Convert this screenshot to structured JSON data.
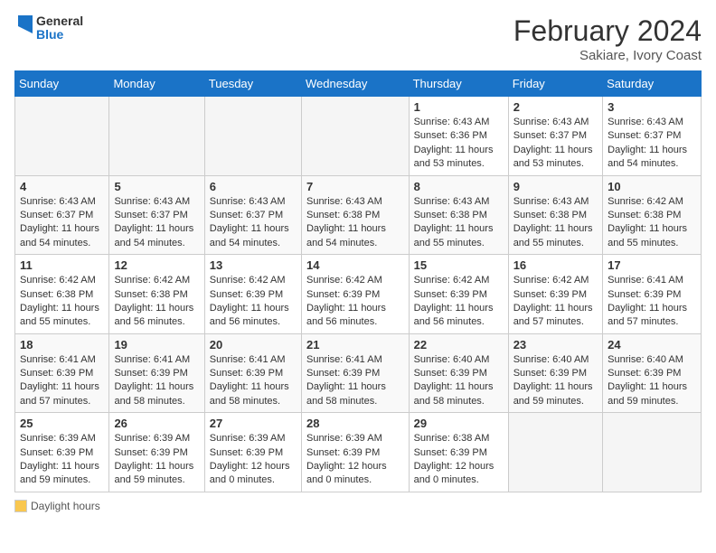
{
  "header": {
    "logo_general": "General",
    "logo_blue": "Blue",
    "main_title": "February 2024",
    "subtitle": "Sakiare, Ivory Coast"
  },
  "columns": [
    "Sunday",
    "Monday",
    "Tuesday",
    "Wednesday",
    "Thursday",
    "Friday",
    "Saturday"
  ],
  "weeks": [
    [
      {
        "day": "",
        "sunrise": "",
        "sunset": "",
        "daylight": "",
        "empty": true
      },
      {
        "day": "",
        "sunrise": "",
        "sunset": "",
        "daylight": "",
        "empty": true
      },
      {
        "day": "",
        "sunrise": "",
        "sunset": "",
        "daylight": "",
        "empty": true
      },
      {
        "day": "",
        "sunrise": "",
        "sunset": "",
        "daylight": "",
        "empty": true
      },
      {
        "day": "1",
        "sunrise": "Sunrise: 6:43 AM",
        "sunset": "Sunset: 6:36 PM",
        "daylight": "Daylight: 11 hours and 53 minutes."
      },
      {
        "day": "2",
        "sunrise": "Sunrise: 6:43 AM",
        "sunset": "Sunset: 6:37 PM",
        "daylight": "Daylight: 11 hours and 53 minutes."
      },
      {
        "day": "3",
        "sunrise": "Sunrise: 6:43 AM",
        "sunset": "Sunset: 6:37 PM",
        "daylight": "Daylight: 11 hours and 54 minutes."
      }
    ],
    [
      {
        "day": "4",
        "sunrise": "Sunrise: 6:43 AM",
        "sunset": "Sunset: 6:37 PM",
        "daylight": "Daylight: 11 hours and 54 minutes."
      },
      {
        "day": "5",
        "sunrise": "Sunrise: 6:43 AM",
        "sunset": "Sunset: 6:37 PM",
        "daylight": "Daylight: 11 hours and 54 minutes."
      },
      {
        "day": "6",
        "sunrise": "Sunrise: 6:43 AM",
        "sunset": "Sunset: 6:37 PM",
        "daylight": "Daylight: 11 hours and 54 minutes."
      },
      {
        "day": "7",
        "sunrise": "Sunrise: 6:43 AM",
        "sunset": "Sunset: 6:38 PM",
        "daylight": "Daylight: 11 hours and 54 minutes."
      },
      {
        "day": "8",
        "sunrise": "Sunrise: 6:43 AM",
        "sunset": "Sunset: 6:38 PM",
        "daylight": "Daylight: 11 hours and 55 minutes."
      },
      {
        "day": "9",
        "sunrise": "Sunrise: 6:43 AM",
        "sunset": "Sunset: 6:38 PM",
        "daylight": "Daylight: 11 hours and 55 minutes."
      },
      {
        "day": "10",
        "sunrise": "Sunrise: 6:42 AM",
        "sunset": "Sunset: 6:38 PM",
        "daylight": "Daylight: 11 hours and 55 minutes."
      }
    ],
    [
      {
        "day": "11",
        "sunrise": "Sunrise: 6:42 AM",
        "sunset": "Sunset: 6:38 PM",
        "daylight": "Daylight: 11 hours and 55 minutes."
      },
      {
        "day": "12",
        "sunrise": "Sunrise: 6:42 AM",
        "sunset": "Sunset: 6:38 PM",
        "daylight": "Daylight: 11 hours and 56 minutes."
      },
      {
        "day": "13",
        "sunrise": "Sunrise: 6:42 AM",
        "sunset": "Sunset: 6:39 PM",
        "daylight": "Daylight: 11 hours and 56 minutes."
      },
      {
        "day": "14",
        "sunrise": "Sunrise: 6:42 AM",
        "sunset": "Sunset: 6:39 PM",
        "daylight": "Daylight: 11 hours and 56 minutes."
      },
      {
        "day": "15",
        "sunrise": "Sunrise: 6:42 AM",
        "sunset": "Sunset: 6:39 PM",
        "daylight": "Daylight: 11 hours and 56 minutes."
      },
      {
        "day": "16",
        "sunrise": "Sunrise: 6:42 AM",
        "sunset": "Sunset: 6:39 PM",
        "daylight": "Daylight: 11 hours and 57 minutes."
      },
      {
        "day": "17",
        "sunrise": "Sunrise: 6:41 AM",
        "sunset": "Sunset: 6:39 PM",
        "daylight": "Daylight: 11 hours and 57 minutes."
      }
    ],
    [
      {
        "day": "18",
        "sunrise": "Sunrise: 6:41 AM",
        "sunset": "Sunset: 6:39 PM",
        "daylight": "Daylight: 11 hours and 57 minutes."
      },
      {
        "day": "19",
        "sunrise": "Sunrise: 6:41 AM",
        "sunset": "Sunset: 6:39 PM",
        "daylight": "Daylight: 11 hours and 58 minutes."
      },
      {
        "day": "20",
        "sunrise": "Sunrise: 6:41 AM",
        "sunset": "Sunset: 6:39 PM",
        "daylight": "Daylight: 11 hours and 58 minutes."
      },
      {
        "day": "21",
        "sunrise": "Sunrise: 6:41 AM",
        "sunset": "Sunset: 6:39 PM",
        "daylight": "Daylight: 11 hours and 58 minutes."
      },
      {
        "day": "22",
        "sunrise": "Sunrise: 6:40 AM",
        "sunset": "Sunset: 6:39 PM",
        "daylight": "Daylight: 11 hours and 58 minutes."
      },
      {
        "day": "23",
        "sunrise": "Sunrise: 6:40 AM",
        "sunset": "Sunset: 6:39 PM",
        "daylight": "Daylight: 11 hours and 59 minutes."
      },
      {
        "day": "24",
        "sunrise": "Sunrise: 6:40 AM",
        "sunset": "Sunset: 6:39 PM",
        "daylight": "Daylight: 11 hours and 59 minutes."
      }
    ],
    [
      {
        "day": "25",
        "sunrise": "Sunrise: 6:39 AM",
        "sunset": "Sunset: 6:39 PM",
        "daylight": "Daylight: 11 hours and 59 minutes."
      },
      {
        "day": "26",
        "sunrise": "Sunrise: 6:39 AM",
        "sunset": "Sunset: 6:39 PM",
        "daylight": "Daylight: 11 hours and 59 minutes."
      },
      {
        "day": "27",
        "sunrise": "Sunrise: 6:39 AM",
        "sunset": "Sunset: 6:39 PM",
        "daylight": "Daylight: 12 hours and 0 minutes."
      },
      {
        "day": "28",
        "sunrise": "Sunrise: 6:39 AM",
        "sunset": "Sunset: 6:39 PM",
        "daylight": "Daylight: 12 hours and 0 minutes."
      },
      {
        "day": "29",
        "sunrise": "Sunrise: 6:38 AM",
        "sunset": "Sunset: 6:39 PM",
        "daylight": "Daylight: 12 hours and 0 minutes."
      },
      {
        "day": "",
        "sunrise": "",
        "sunset": "",
        "daylight": "",
        "empty": true
      },
      {
        "day": "",
        "sunrise": "",
        "sunset": "",
        "daylight": "",
        "empty": true
      }
    ]
  ],
  "legend": {
    "label": "Daylight hours"
  }
}
